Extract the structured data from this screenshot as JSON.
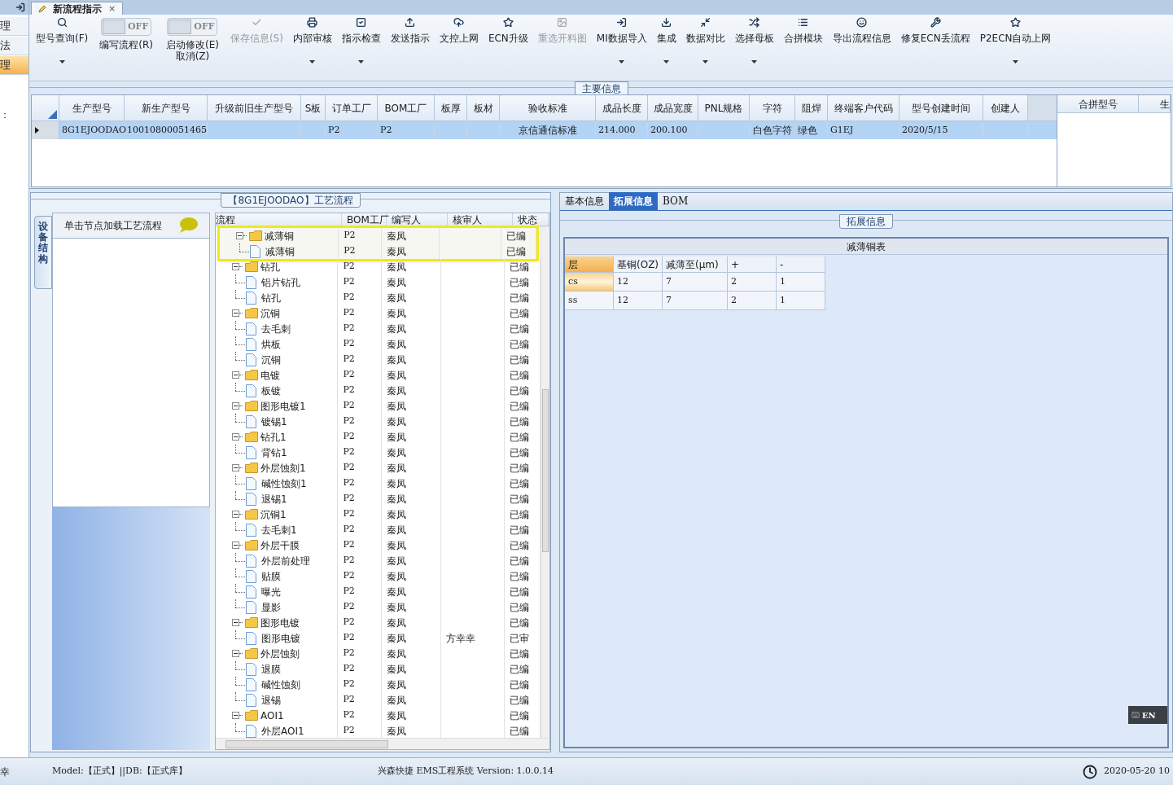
{
  "left_nav": {
    "items": [
      {
        "label": "理",
        "selected": false
      },
      {
        "label": "法",
        "selected": false
      },
      {
        "label": "理",
        "selected": true
      }
    ],
    "note": "："
  },
  "document_tab": {
    "title": "新流程指示",
    "close": "×"
  },
  "toolbar": [
    {
      "kind": "button",
      "label": "型号查询(F)",
      "disabled": false,
      "dropdown": true
    },
    {
      "kind": "toggle",
      "label": "编写流程(R)",
      "on": false,
      "toggle_text": "OFF"
    },
    {
      "kind": "toggle",
      "label": "启动修改(E)",
      "label_2": "取消(Z)",
      "on": false,
      "toggle_text": "OFF"
    },
    {
      "kind": "button",
      "label": "保存信息(S)",
      "disabled": true,
      "dropdown": false
    },
    {
      "kind": "button",
      "label": "内部审核",
      "disabled": false,
      "dropdown": true
    },
    {
      "kind": "button",
      "label": "指示检查",
      "disabled": false,
      "dropdown": true
    },
    {
      "kind": "button",
      "label": "发送指示",
      "disabled": false,
      "dropdown": false
    },
    {
      "kind": "button",
      "label": "文控上网",
      "disabled": false,
      "dropdown": false
    },
    {
      "kind": "button",
      "label": "ECN升级",
      "disabled": false,
      "dropdown": false
    },
    {
      "kind": "button",
      "label": "重选开料图",
      "disabled": true,
      "dropdown": false
    },
    {
      "kind": "button",
      "label": "MI数据导入",
      "disabled": false,
      "dropdown": true
    },
    {
      "kind": "button",
      "label": "集成",
      "disabled": false,
      "dropdown": true
    },
    {
      "kind": "button",
      "label": "数据对比",
      "disabled": false,
      "dropdown": true
    },
    {
      "kind": "button",
      "label": "选择母板",
      "disabled": false,
      "dropdown": true
    },
    {
      "kind": "button",
      "label": "合拼模块",
      "disabled": false,
      "dropdown": false
    },
    {
      "kind": "button",
      "label": "导出流程信息",
      "disabled": false,
      "dropdown": false
    },
    {
      "kind": "button",
      "label": "修复ECN丢流程",
      "disabled": false,
      "dropdown": false
    },
    {
      "kind": "button",
      "label": "P2ECN自动上网",
      "disabled": false,
      "dropdown": true
    }
  ],
  "main_info": {
    "title": "主要信息",
    "columns": [
      "生产型号",
      "新生产型号",
      "升级前旧生产型号",
      "S板",
      "订单工厂",
      "BOM工厂",
      "板厚",
      "板材",
      "验收标准",
      "成品长度",
      "成品宽度",
      "PNL规格",
      "字符",
      "阻焊",
      "终端客户代码",
      "型号创建时间",
      "创建人"
    ],
    "rows": [
      {
        "selected": true,
        "cells": [
          "8G1EJOODAO",
          "10010800051465",
          null,
          null,
          "P2",
          "P2",
          null,
          null,
          "京信通信标准",
          "214.000",
          "200.100",
          null,
          "白色字符",
          "绿色",
          "G1EJ",
          "2020/5/15",
          null
        ]
      }
    ],
    "side_columns": [
      "合拼型号",
      "生"
    ]
  },
  "process": {
    "title": "【8G1EJOODAO】工艺流程",
    "side_tab": "设备结构",
    "panel_title": "单击节点加载工艺流程",
    "columns": [
      "流程",
      "BOM工厂",
      "编写人",
      "核审人",
      "状态"
    ],
    "nodes": [
      {
        "name": "减薄铜",
        "bom": "P2",
        "writer": "秦凤",
        "status": "已编",
        "expanded": true,
        "highlighted": true,
        "children": [
          {
            "name": "减薄铜",
            "bom": "P2",
            "writer": "秦凤",
            "status": "已编"
          }
        ]
      },
      {
        "name": "钻孔",
        "bom": "P2",
        "writer": "秦凤",
        "status": "已编",
        "expanded": true,
        "highlighted": false,
        "children": [
          {
            "name": "铝片钻孔",
            "bom": "P2",
            "writer": "秦凤",
            "status": "已编"
          },
          {
            "name": "钻孔",
            "bom": "P2",
            "writer": "秦凤",
            "status": "已编"
          }
        ]
      },
      {
        "name": "沉铜",
        "bom": "P2",
        "writer": "秦凤",
        "status": "已编",
        "expanded": true,
        "highlighted": false,
        "children": [
          {
            "name": "去毛刺",
            "bom": "P2",
            "writer": "秦凤",
            "status": "已编"
          },
          {
            "name": "烘板",
            "bom": "P2",
            "writer": "秦凤",
            "status": "已编"
          },
          {
            "name": "沉铜",
            "bom": "P2",
            "writer": "秦凤",
            "status": "已编"
          }
        ]
      },
      {
        "name": "电镀",
        "bom": "P2",
        "writer": "秦凤",
        "status": "已编",
        "expanded": true,
        "highlighted": false,
        "children": [
          {
            "name": "板镀",
            "bom": "P2",
            "writer": "秦凤",
            "status": "已编"
          }
        ]
      },
      {
        "name": "图形电镀1",
        "bom": "P2",
        "writer": "秦凤",
        "status": "已编",
        "expanded": true,
        "highlighted": false,
        "children": [
          {
            "name": "镀锡1",
            "bom": "P2",
            "writer": "秦凤",
            "status": "已编"
          }
        ]
      },
      {
        "name": "钻孔1",
        "bom": "P2",
        "writer": "秦凤",
        "status": "已编",
        "expanded": true,
        "highlighted": false,
        "children": [
          {
            "name": "背钻1",
            "bom": "P2",
            "writer": "秦凤",
            "status": "已编"
          }
        ]
      },
      {
        "name": "外层蚀刻1",
        "bom": "P2",
        "writer": "秦凤",
        "status": "已编",
        "expanded": true,
        "highlighted": false,
        "children": [
          {
            "name": "碱性蚀刻1",
            "bom": "P2",
            "writer": "秦凤",
            "status": "已编"
          },
          {
            "name": "退锡1",
            "bom": "P2",
            "writer": "秦凤",
            "status": "已编"
          }
        ]
      },
      {
        "name": "沉铜1",
        "bom": "P2",
        "writer": "秦凤",
        "status": "已编",
        "expanded": true,
        "highlighted": false,
        "children": [
          {
            "name": "去毛刺1",
            "bom": "P2",
            "writer": "秦凤",
            "status": "已编"
          }
        ]
      },
      {
        "name": "外层干膜",
        "bom": "P2",
        "writer": "秦凤",
        "status": "已编",
        "expanded": true,
        "highlighted": false,
        "children": [
          {
            "name": "外层前处理",
            "bom": "P2",
            "writer": "秦凤",
            "status": "已编"
          },
          {
            "name": "贴膜",
            "bom": "P2",
            "writer": "秦凤",
            "status": "已编"
          },
          {
            "name": "曝光",
            "bom": "P2",
            "writer": "秦凤",
            "status": "已编"
          },
          {
            "name": "显影",
            "bom": "P2",
            "writer": "秦凤",
            "status": "已编"
          }
        ]
      },
      {
        "name": "图形电镀",
        "bom": "P2",
        "writer": "秦凤",
        "status": "已编",
        "expanded": true,
        "highlighted": false,
        "children": [
          {
            "name": "图形电镀",
            "bom": "P2",
            "writer": "秦凤",
            "reviewer": "方幸幸",
            "status": "已审"
          }
        ]
      },
      {
        "name": "外层蚀刻",
        "bom": "P2",
        "writer": "秦凤",
        "status": "已编",
        "expanded": true,
        "highlighted": false,
        "children": [
          {
            "name": "退膜",
            "bom": "P2",
            "writer": "秦凤",
            "status": "已编"
          },
          {
            "name": "碱性蚀刻",
            "bom": "P2",
            "writer": "秦凤",
            "status": "已编"
          },
          {
            "name": "退锡",
            "bom": "P2",
            "writer": "秦凤",
            "status": "已编"
          }
        ]
      },
      {
        "name": "AOI1",
        "bom": "P2",
        "writer": "秦凤",
        "status": "已编",
        "expanded": true,
        "highlighted": false,
        "children": [
          {
            "name": "外层AOI1",
            "bom": "P2",
            "writer": "秦凤",
            "status": "已编"
          }
        ]
      }
    ]
  },
  "detail": {
    "tabs": [
      {
        "label": "基本信息",
        "selected": false
      },
      {
        "label": "拓展信息",
        "selected": true
      },
      {
        "label": "BOM",
        "selected": false
      }
    ],
    "group_title": "拓展信息",
    "table_title": "减薄铜表",
    "columns": [
      "层",
      "基铜(OZ)",
      "减薄至(μm)",
      "+",
      "-"
    ],
    "rows": [
      {
        "selected": true,
        "cells": [
          "cs",
          "12",
          "7",
          "2",
          "1"
        ]
      },
      {
        "selected": false,
        "cells": [
          "ss",
          "12",
          "7",
          "2",
          "1"
        ]
      }
    ]
  },
  "ime": {
    "label": "EN"
  },
  "status_bar": {
    "user": "幸",
    "model": "Model:【正式】||DB:【正式库】",
    "app": "兴森快捷 EMS工程系统 Version: 1.0.0.14",
    "date": "2020-05-20 10"
  }
}
